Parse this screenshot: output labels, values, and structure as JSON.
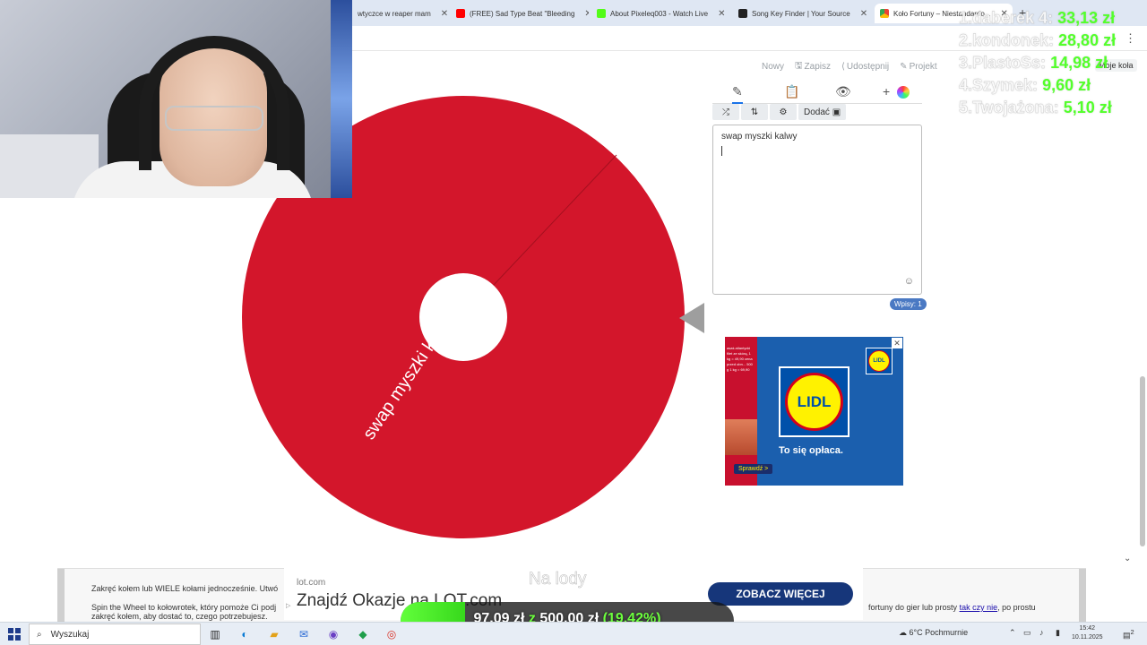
{
  "browser": {
    "tabs": [
      {
        "label": "wtyczce w reaper mam",
        "fav_color": "#d62828"
      },
      {
        "label": "(FREE) Sad Type Beat \"Bleeding",
        "fav_color": "#ff0000"
      },
      {
        "label": "About Pixeleq003 - Watch Live",
        "fav_color": "#53fc18"
      },
      {
        "label": "Song Key Finder | Your Source",
        "fav_color": "#222222"
      },
      {
        "label": "Koło Fortuny – Niestandardo...",
        "fav_color": "#4285f4",
        "active": true
      }
    ],
    "new_tab": "+",
    "menu": "⋮"
  },
  "toolbar": {
    "new": "Nowy",
    "save": "Zapisz",
    "share": "Udostępnij",
    "projects": "Projekt",
    "my_wheels": "Moje koła"
  },
  "wheel": {
    "segment_label": "swap myszki kalwy",
    "color": "#d3162b"
  },
  "editor": {
    "tab_icons": [
      "✎",
      "📋",
      "👁",
      "+"
    ],
    "buttons": [
      "⤮",
      "⇅",
      "⚙"
    ],
    "add_label": "Dodać",
    "entries_text": "swap myszki kalwy",
    "entries_count": "Wpisy: 1",
    "emoji": "☺"
  },
  "ad_lidl": {
    "logo": "LIDL",
    "tagline": "To się opłaca.",
    "cta": "Sprawdź >",
    "strip_text": "asaś atlantycki filet ze skórą, 1 kg = 49,90 cena przed obn... 500 g 1 kg = 69,90",
    "close": "✕"
  },
  "leaderboard": [
    {
      "name": "1.daberek 4:",
      "amount": "33,13 zł"
    },
    {
      "name": "2.kondonek:",
      "amount": "28,80 zł"
    },
    {
      "name": "3.PlastoSs:",
      "amount": "14,98 zł"
    },
    {
      "name": "4.Szymek:",
      "amount": "9,60 zł"
    },
    {
      "name": "5.Twojażona:",
      "amount": "5,10 zł"
    }
  ],
  "page_bottom": {
    "line1": "Zakręć kołem lub WIELE kołami jednocześnie. Utwó",
    "line2": "Spin the Wheel to kołowrotek, który pomoże Ci podj",
    "line2b": "zakręć kołem, aby dostać to, czego potrzebujesz.",
    "line3_pre": "fortuny do gier lub prosty",
    "line3_link": "tak czy nie",
    "line3_post": ", po prostu"
  },
  "ad_lot": {
    "domain": "lot.com",
    "headline": "Znajdź Okazje na LOT.com",
    "cta": "ZOBACZ WIĘCEJ"
  },
  "ghost_text": "Na lody",
  "donation_goal": {
    "current": "97,09 zł",
    "separator": "z",
    "target": "500,00 zł",
    "percent_label": "(19.42%)",
    "progress": 0.1942
  },
  "taskbar": {
    "search_placeholder": "Wyszukaj",
    "weather": "6°C  Pochmurnie",
    "time": "15:42",
    "date": "10.11.2025",
    "notif_count": "2"
  }
}
